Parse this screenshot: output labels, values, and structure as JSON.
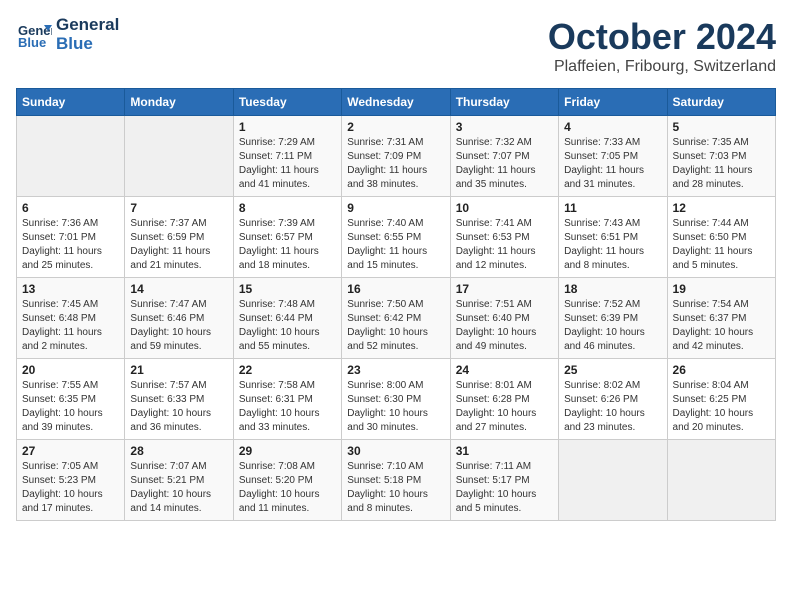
{
  "header": {
    "logo_line1": "General",
    "logo_line2": "Blue",
    "month": "October 2024",
    "location": "Plaffeien, Fribourg, Switzerland"
  },
  "days_of_week": [
    "Sunday",
    "Monday",
    "Tuesday",
    "Wednesday",
    "Thursday",
    "Friday",
    "Saturday"
  ],
  "weeks": [
    [
      {
        "day": "",
        "info": ""
      },
      {
        "day": "",
        "info": ""
      },
      {
        "day": "1",
        "info": "Sunrise: 7:29 AM\nSunset: 7:11 PM\nDaylight: 11 hours and 41 minutes."
      },
      {
        "day": "2",
        "info": "Sunrise: 7:31 AM\nSunset: 7:09 PM\nDaylight: 11 hours and 38 minutes."
      },
      {
        "day": "3",
        "info": "Sunrise: 7:32 AM\nSunset: 7:07 PM\nDaylight: 11 hours and 35 minutes."
      },
      {
        "day": "4",
        "info": "Sunrise: 7:33 AM\nSunset: 7:05 PM\nDaylight: 11 hours and 31 minutes."
      },
      {
        "day": "5",
        "info": "Sunrise: 7:35 AM\nSunset: 7:03 PM\nDaylight: 11 hours and 28 minutes."
      }
    ],
    [
      {
        "day": "6",
        "info": "Sunrise: 7:36 AM\nSunset: 7:01 PM\nDaylight: 11 hours and 25 minutes."
      },
      {
        "day": "7",
        "info": "Sunrise: 7:37 AM\nSunset: 6:59 PM\nDaylight: 11 hours and 21 minutes."
      },
      {
        "day": "8",
        "info": "Sunrise: 7:39 AM\nSunset: 6:57 PM\nDaylight: 11 hours and 18 minutes."
      },
      {
        "day": "9",
        "info": "Sunrise: 7:40 AM\nSunset: 6:55 PM\nDaylight: 11 hours and 15 minutes."
      },
      {
        "day": "10",
        "info": "Sunrise: 7:41 AM\nSunset: 6:53 PM\nDaylight: 11 hours and 12 minutes."
      },
      {
        "day": "11",
        "info": "Sunrise: 7:43 AM\nSunset: 6:51 PM\nDaylight: 11 hours and 8 minutes."
      },
      {
        "day": "12",
        "info": "Sunrise: 7:44 AM\nSunset: 6:50 PM\nDaylight: 11 hours and 5 minutes."
      }
    ],
    [
      {
        "day": "13",
        "info": "Sunrise: 7:45 AM\nSunset: 6:48 PM\nDaylight: 11 hours and 2 minutes."
      },
      {
        "day": "14",
        "info": "Sunrise: 7:47 AM\nSunset: 6:46 PM\nDaylight: 10 hours and 59 minutes."
      },
      {
        "day": "15",
        "info": "Sunrise: 7:48 AM\nSunset: 6:44 PM\nDaylight: 10 hours and 55 minutes."
      },
      {
        "day": "16",
        "info": "Sunrise: 7:50 AM\nSunset: 6:42 PM\nDaylight: 10 hours and 52 minutes."
      },
      {
        "day": "17",
        "info": "Sunrise: 7:51 AM\nSunset: 6:40 PM\nDaylight: 10 hours and 49 minutes."
      },
      {
        "day": "18",
        "info": "Sunrise: 7:52 AM\nSunset: 6:39 PM\nDaylight: 10 hours and 46 minutes."
      },
      {
        "day": "19",
        "info": "Sunrise: 7:54 AM\nSunset: 6:37 PM\nDaylight: 10 hours and 42 minutes."
      }
    ],
    [
      {
        "day": "20",
        "info": "Sunrise: 7:55 AM\nSunset: 6:35 PM\nDaylight: 10 hours and 39 minutes."
      },
      {
        "day": "21",
        "info": "Sunrise: 7:57 AM\nSunset: 6:33 PM\nDaylight: 10 hours and 36 minutes."
      },
      {
        "day": "22",
        "info": "Sunrise: 7:58 AM\nSunset: 6:31 PM\nDaylight: 10 hours and 33 minutes."
      },
      {
        "day": "23",
        "info": "Sunrise: 8:00 AM\nSunset: 6:30 PM\nDaylight: 10 hours and 30 minutes."
      },
      {
        "day": "24",
        "info": "Sunrise: 8:01 AM\nSunset: 6:28 PM\nDaylight: 10 hours and 27 minutes."
      },
      {
        "day": "25",
        "info": "Sunrise: 8:02 AM\nSunset: 6:26 PM\nDaylight: 10 hours and 23 minutes."
      },
      {
        "day": "26",
        "info": "Sunrise: 8:04 AM\nSunset: 6:25 PM\nDaylight: 10 hours and 20 minutes."
      }
    ],
    [
      {
        "day": "27",
        "info": "Sunrise: 7:05 AM\nSunset: 5:23 PM\nDaylight: 10 hours and 17 minutes."
      },
      {
        "day": "28",
        "info": "Sunrise: 7:07 AM\nSunset: 5:21 PM\nDaylight: 10 hours and 14 minutes."
      },
      {
        "day": "29",
        "info": "Sunrise: 7:08 AM\nSunset: 5:20 PM\nDaylight: 10 hours and 11 minutes."
      },
      {
        "day": "30",
        "info": "Sunrise: 7:10 AM\nSunset: 5:18 PM\nDaylight: 10 hours and 8 minutes."
      },
      {
        "day": "31",
        "info": "Sunrise: 7:11 AM\nSunset: 5:17 PM\nDaylight: 10 hours and 5 minutes."
      },
      {
        "day": "",
        "info": ""
      },
      {
        "day": "",
        "info": ""
      }
    ]
  ]
}
